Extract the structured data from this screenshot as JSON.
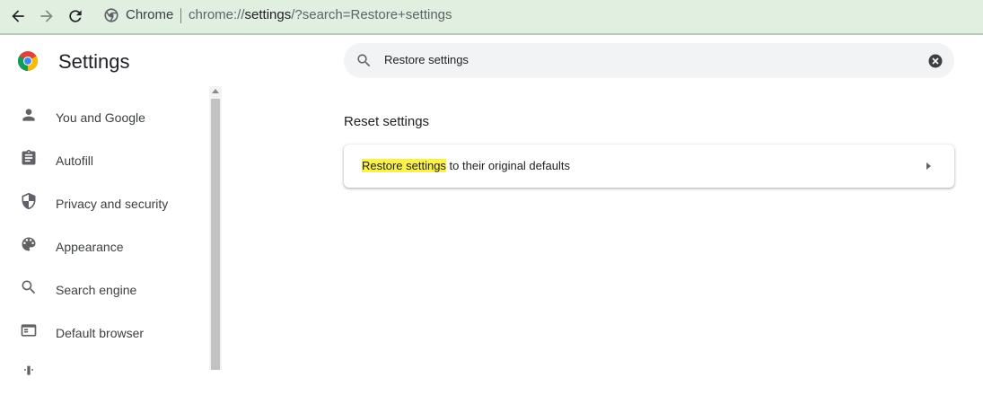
{
  "browser": {
    "site_name": "Chrome",
    "url_scheme": "chrome://",
    "url_host": "settings",
    "url_path": "/?search=Restore+settings"
  },
  "header": {
    "title": "Settings",
    "search_value": "Restore settings"
  },
  "sidebar": {
    "items": [
      {
        "label": "You and Google",
        "icon": "person-icon"
      },
      {
        "label": "Autofill",
        "icon": "clipboard-icon"
      },
      {
        "label": "Privacy and security",
        "icon": "shield-icon"
      },
      {
        "label": "Appearance",
        "icon": "palette-icon"
      },
      {
        "label": "Search engine",
        "icon": "search-icon"
      },
      {
        "label": "Default browser",
        "icon": "browser-window-icon"
      }
    ]
  },
  "main": {
    "section_title": "Reset settings",
    "row_highlight": "Restore settings",
    "row_rest": " to their original defaults"
  },
  "colors": {
    "toolbar_bg": "#e1efe0",
    "highlight": "#fcf247",
    "accent_blue": "#1a73e8"
  }
}
